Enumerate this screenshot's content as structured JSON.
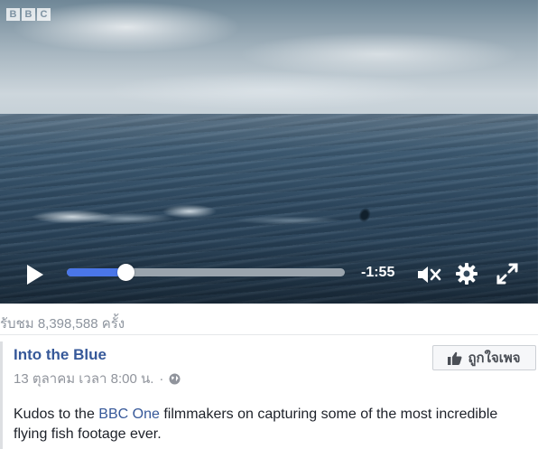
{
  "video": {
    "channel_logo": [
      "B",
      "B",
      "C"
    ],
    "progress_percent": 21,
    "time_remaining": "-1:55",
    "controls": {
      "play_icon": "play-icon",
      "mute_icon": "muted-speaker-icon",
      "settings_icon": "gear-icon",
      "fullscreen_icon": "expand-icon"
    },
    "accent_color": "#4a76e8"
  },
  "stats": {
    "views": "รับชม 8,398,588 ครั้ง"
  },
  "post": {
    "page_name": "Into the Blue",
    "date": "13 ตุลาคม เวลา 8:00 น.",
    "separator": "·",
    "privacy_icon": "globe-icon",
    "like_button_label": "ถูกใจเพจ",
    "like_button_icon": "thumbs-up-icon",
    "body_before": "Kudos to the ",
    "body_link": "BBC One",
    "body_after": " filmmakers on capturing some of the most incredible flying fish footage ever."
  }
}
